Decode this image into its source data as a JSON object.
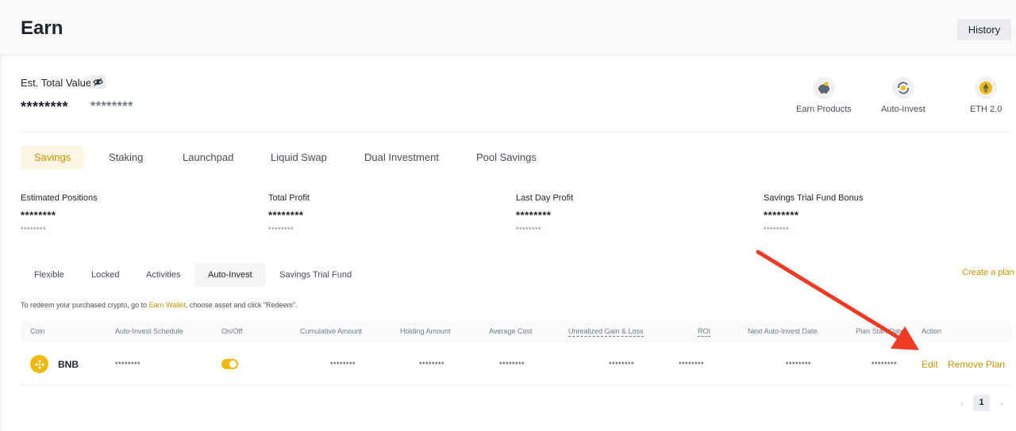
{
  "header": {
    "title": "Earn",
    "history_label": "History"
  },
  "summary": {
    "label": "Est. Total Value",
    "masked_value": "********",
    "masked_sub": "********"
  },
  "quick_links": [
    {
      "label": "Earn Products",
      "icon": "piggy-bank-icon"
    },
    {
      "label": "Auto-Invest",
      "icon": "auto-invest-icon"
    },
    {
      "label": "ETH 2.0",
      "icon": "eth-icon"
    }
  ],
  "tabs": [
    "Savings",
    "Staking",
    "Launchpad",
    "Liquid Swap",
    "Dual Investment",
    "Pool Savings"
  ],
  "active_tab": "Savings",
  "stats": [
    {
      "label": "Estimated Positions",
      "v1": "********",
      "v2": "********"
    },
    {
      "label": "Total Profit",
      "v1": "********",
      "v2": "********"
    },
    {
      "label": "Last Day Profit",
      "v1": "********",
      "v2": "********"
    },
    {
      "label": "Savings Trial Fund Bonus",
      "v1": "********",
      "v2": "********"
    }
  ],
  "subtabs": [
    "Flexible",
    "Locked",
    "Activities",
    "Auto-Invest",
    "Savings Trial Fund"
  ],
  "active_subtab": "Auto-Invest",
  "create_plan": "Create a plan",
  "redeem_note": {
    "before": "To redeem your purchased crypto, go to ",
    "link": "Earn Wallet",
    "after": ", choose asset and click \"Redeem\"."
  },
  "table": {
    "headers": [
      "Coin",
      "Auto-Invest Schedule",
      "On/Off",
      "Cumulative Amount",
      "Holding Amount",
      "Average Cost",
      "Unrealized Gain & Loss",
      "ROI",
      "Next Auto-Invest Date",
      "Plan Start Date",
      "Action"
    ],
    "row": {
      "coin": "BNB",
      "schedule": "********",
      "on": true,
      "cumulative": "********",
      "holding": "********",
      "avg_cost": "********",
      "unrealized": "********",
      "roi": "********",
      "next_date": "********",
      "start_date": "********",
      "actions": [
        "Edit",
        "Remove Plan"
      ]
    }
  },
  "pagination": {
    "current": "1"
  },
  "colors": {
    "accent": "#c99400",
    "yellow": "#f0b90b",
    "annotation_arrow": "#f03a24"
  }
}
